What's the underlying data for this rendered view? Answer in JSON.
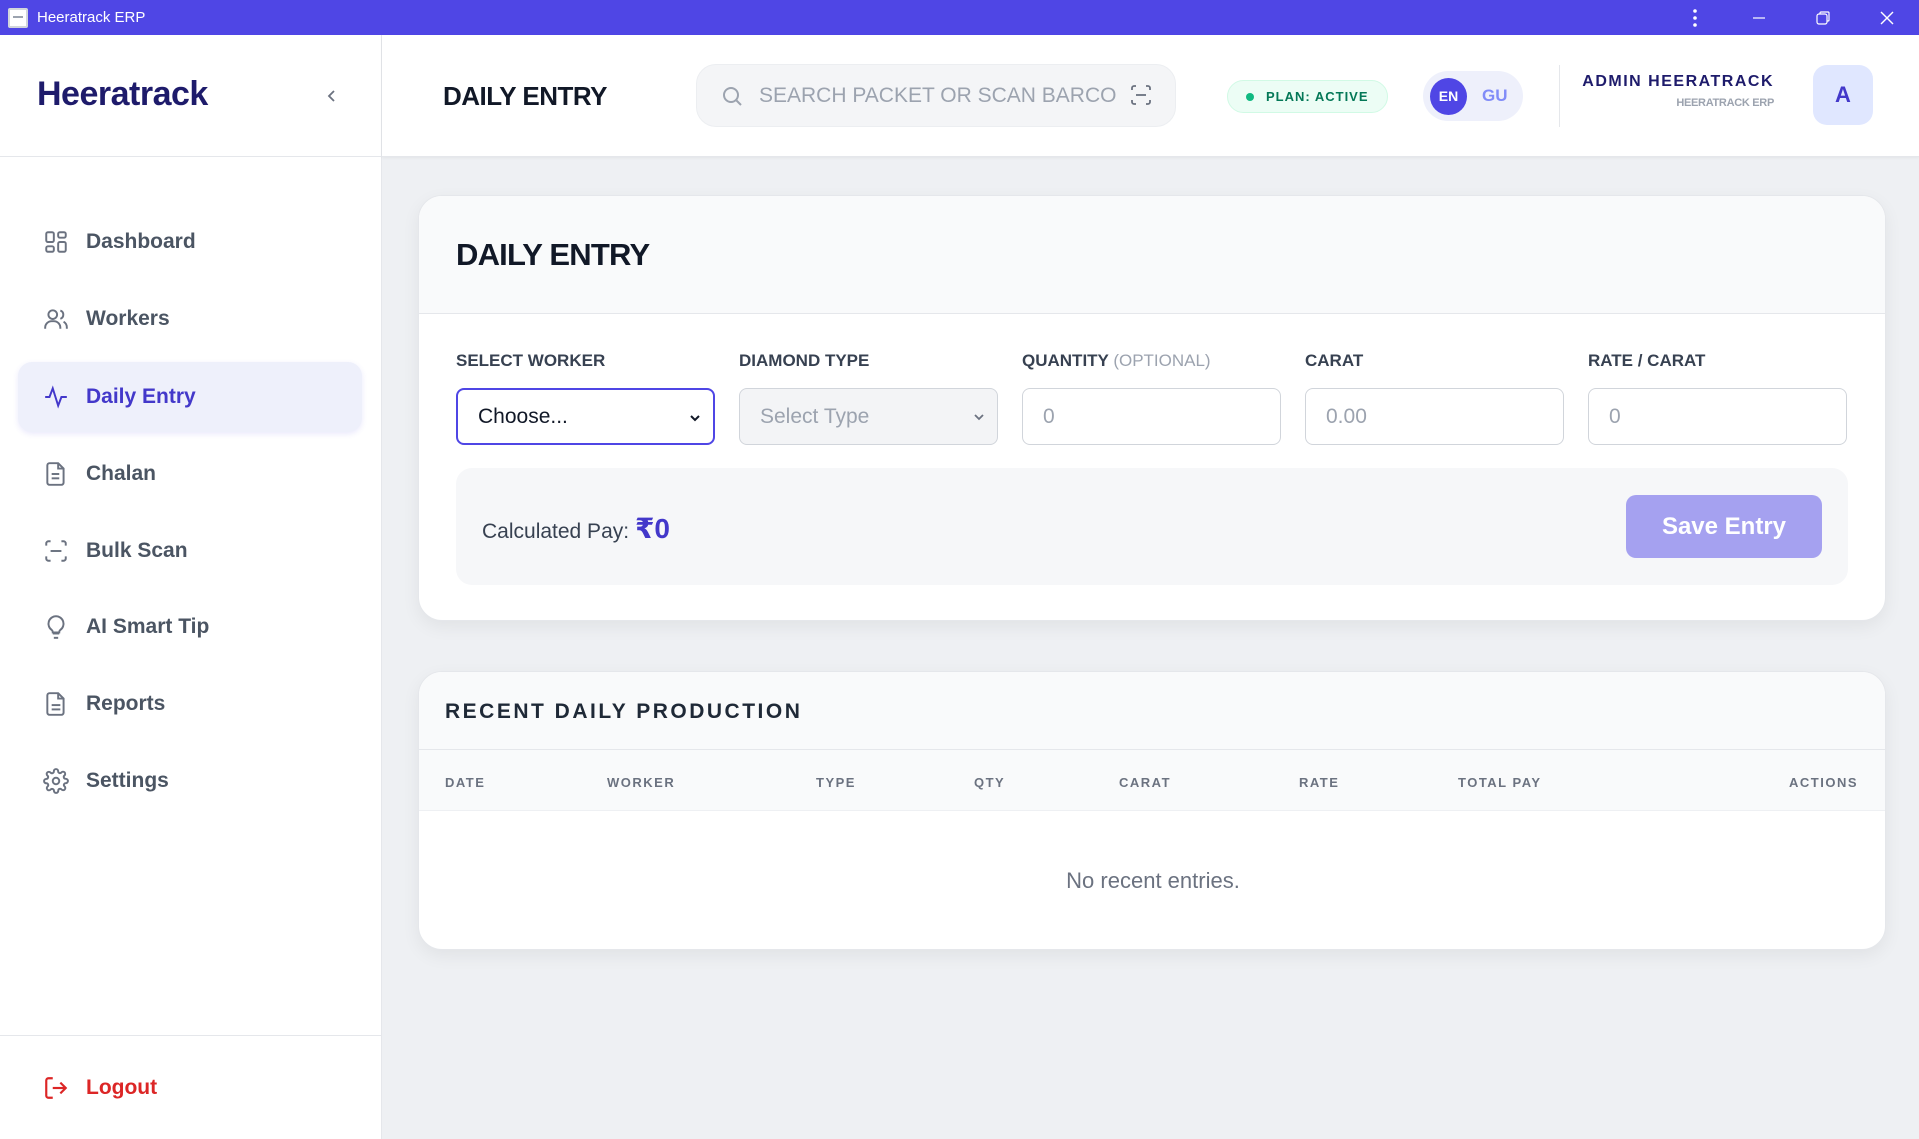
{
  "window": {
    "title": "Heeratrack ERP"
  },
  "sidebar": {
    "logo": "Heeratrack",
    "items": [
      {
        "label": "Dashboard",
        "icon": "grid-icon"
      },
      {
        "label": "Workers",
        "icon": "users-icon"
      },
      {
        "label": "Daily Entry",
        "icon": "activity-icon",
        "active": true
      },
      {
        "label": "Chalan",
        "icon": "document-icon"
      },
      {
        "label": "Bulk Scan",
        "icon": "scan-icon"
      },
      {
        "label": "AI Smart Tip",
        "icon": "lightbulb-icon"
      },
      {
        "label": "Reports",
        "icon": "report-icon"
      },
      {
        "label": "Settings",
        "icon": "gear-icon"
      }
    ],
    "logout_label": "Logout"
  },
  "header": {
    "page_title": "DAILY ENTRY",
    "search_placeholder": "SEARCH PACKET OR SCAN BARCO",
    "plan_badge": "PLAN: ACTIVE",
    "lang_en": "EN",
    "lang_gu": "GU",
    "user_name": "ADMIN HEERATRACK",
    "user_org": "HEERATRACK ERP",
    "avatar_initial": "A"
  },
  "entry_form": {
    "title": "DAILY ENTRY",
    "worker_label": "SELECT WORKER",
    "worker_value": "Choose...",
    "type_label": "DIAMOND TYPE",
    "type_value": "Select Type",
    "quantity_label": "QUANTITY",
    "quantity_optional": "(OPTIONAL)",
    "quantity_placeholder": "0",
    "carat_label": "CARAT",
    "carat_placeholder": "0.00",
    "rate_label": "RATE / CARAT",
    "rate_placeholder": "0",
    "calc_label": "Calculated Pay:",
    "calc_value": "₹0",
    "save_label": "Save Entry"
  },
  "recent": {
    "title": "RECENT DAILY PRODUCTION",
    "columns": [
      "DATE",
      "WORKER",
      "TYPE",
      "QTY",
      "CARAT",
      "RATE",
      "TOTAL PAY",
      "ACTIONS"
    ],
    "empty_text": "No recent entries."
  },
  "colors": {
    "accent": "#4f46e5",
    "brand_text": "#1e1b6b",
    "danger": "#dc2626",
    "success": "#10b981"
  }
}
